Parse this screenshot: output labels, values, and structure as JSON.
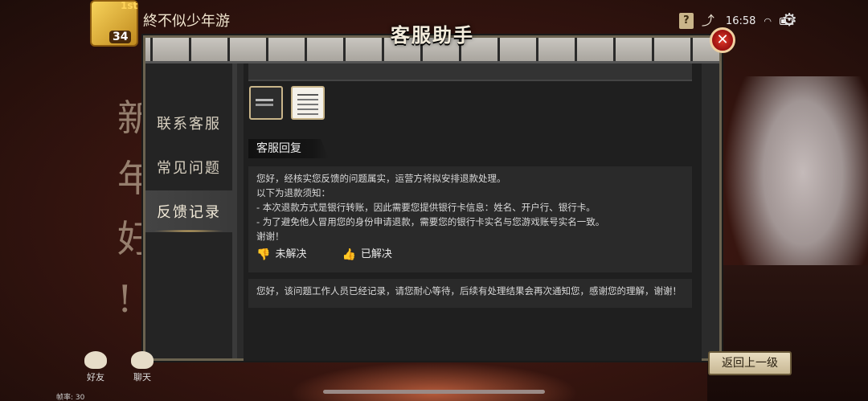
{
  "background": {
    "glyphs": [
      "新",
      "年",
      "好",
      "!"
    ]
  },
  "player": {
    "name": "終不似少年游",
    "badge": "1st",
    "level": "34"
  },
  "status_bar": {
    "time": "16:58"
  },
  "dialog": {
    "title": "客服助手",
    "sidebar": [
      {
        "label": "联系客服",
        "active": false
      },
      {
        "label": "常见问题",
        "active": false
      },
      {
        "label": "反馈记录",
        "active": true
      }
    ],
    "reply_label": "客服回复",
    "message_1": {
      "lines": [
        "您好，经核实您反馈的问题属实，运营方将拟安排退款处理。",
        "以下为退款须知：",
        "- 本次退款方式是银行转账，因此需要您提供银行卡信息：姓名、开户行、银行卡。",
        "- 为了避免他人冒用您的身份申请退款，需要您的银行卡实名与您游戏账号实名一致。",
        "谢谢！"
      ],
      "unresolved_label": "未解决",
      "resolved_label": "已解决"
    },
    "message_2": "您好，该问题工作人员已经记录，请您耐心等待，后续有处理结果会再次通知您，感谢您的理解，谢谢！",
    "back_label": "返回上一级",
    "close_symbol": "✕"
  },
  "bottom": {
    "friends_label": "好友",
    "chat_label": "聊天",
    "fps_label": "帧率: 30"
  }
}
